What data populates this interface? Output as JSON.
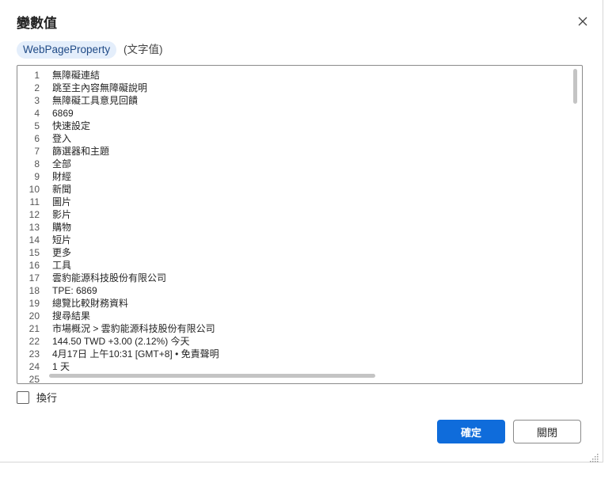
{
  "dialog": {
    "title": "變數值",
    "variable_name": "WebPageProperty",
    "variable_type": "(文字值)",
    "lines": [
      {
        "num": "1",
        "text": "無障礙連結"
      },
      {
        "num": "2",
        "text": "跳至主內容無障礙說明"
      },
      {
        "num": "3",
        "text": "無障礙工具意見回饋"
      },
      {
        "num": "4",
        "text": "6869"
      },
      {
        "num": "5",
        "text": "快速設定"
      },
      {
        "num": "6",
        "text": "登入"
      },
      {
        "num": "7",
        "text": "篩選器和主題"
      },
      {
        "num": "8",
        "text": "全部"
      },
      {
        "num": "9",
        "text": "財經"
      },
      {
        "num": "10",
        "text": "新聞"
      },
      {
        "num": "11",
        "text": "圖片"
      },
      {
        "num": "12",
        "text": "影片"
      },
      {
        "num": "13",
        "text": "購物"
      },
      {
        "num": "14",
        "text": "短片"
      },
      {
        "num": "15",
        "text": "更多"
      },
      {
        "num": "16",
        "text": "工具"
      },
      {
        "num": "17",
        "text": "雲豹能源科技股份有限公司"
      },
      {
        "num": "18",
        "text": "TPE: 6869"
      },
      {
        "num": "19",
        "text": "總覽比較財務資料"
      },
      {
        "num": "20",
        "text": "搜尋結果"
      },
      {
        "num": "21",
        "text": "市場概況 > 雲豹能源科技股份有限公司"
      },
      {
        "num": "22",
        "text": "144.50 TWD +3.00 (2.12%) 今天"
      },
      {
        "num": "23",
        "text": "4月17日 上午10:31 [GMT+8] • 免責聲明"
      },
      {
        "num": "24",
        "text": "1 天"
      },
      {
        "num": "25",
        "text": ""
      }
    ],
    "wrap_label": "換行",
    "wrap_checked": false,
    "ok_label": "確定",
    "close_label": "關閉"
  },
  "colors": {
    "accent": "#0f6cdb",
    "chip_bg": "#e4eefb"
  }
}
